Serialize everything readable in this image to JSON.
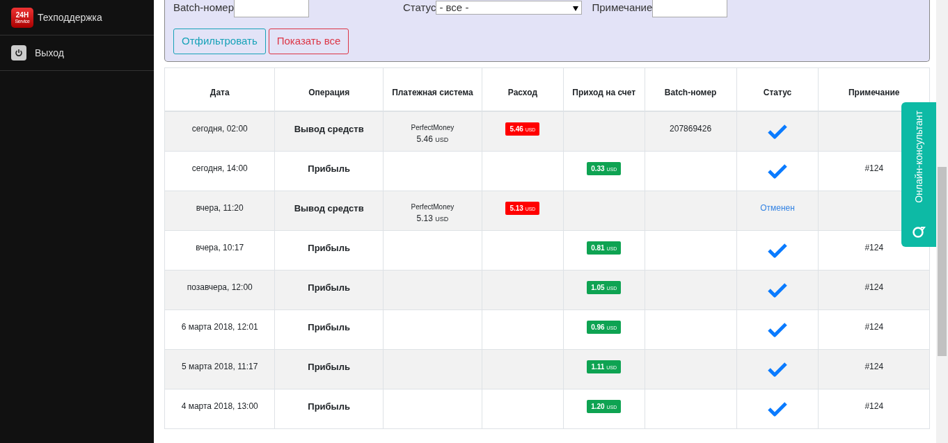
{
  "sidebar": {
    "items": [
      {
        "kind": "logo",
        "label": "Техподдержка",
        "logo_text": "24H",
        "logo_sub": "Service"
      },
      {
        "kind": "power",
        "label": "Выход"
      }
    ]
  },
  "filter": {
    "fields": [
      {
        "kind": "input",
        "label": "Batch-номер"
      },
      {
        "kind": "select",
        "label": "Статус",
        "value": "- все -"
      },
      {
        "kind": "input",
        "label": "Примечание"
      }
    ],
    "buttons": [
      {
        "kind": "info",
        "label": "Отфильтровать"
      },
      {
        "kind": "danger",
        "label": "Показать все"
      }
    ]
  },
  "table": {
    "columns": [
      "Дата",
      "Операция",
      "Платежная система",
      "Расход",
      "Приход на счет",
      "Batch-номер",
      "Статус",
      "Примечание"
    ],
    "rows": [
      {
        "date": "сегодня, 02:00",
        "operation": "Вывод средств",
        "payment": {
          "name": "PerfectMoney",
          "amount": "5.46",
          "currency": "USD"
        },
        "expense": {
          "amount": "5.46",
          "currency": "USD"
        },
        "batch": "207869426",
        "status": {
          "kind": "check"
        }
      },
      {
        "date": "сегодня, 14:00",
        "operation": "Прибыль",
        "income": {
          "amount": "0.33",
          "currency": "USD"
        },
        "status": {
          "kind": "check"
        },
        "note": "#124"
      },
      {
        "date": "вчера, 11:20",
        "operation": "Вывод средств",
        "payment": {
          "name": "PerfectMoney",
          "amount": "5.13",
          "currency": "USD"
        },
        "expense": {
          "amount": "5.13",
          "currency": "USD"
        },
        "status": {
          "kind": "text",
          "text": "Отменен"
        }
      },
      {
        "date": "вчера, 10:17",
        "operation": "Прибыль",
        "income": {
          "amount": "0.81",
          "currency": "USD"
        },
        "status": {
          "kind": "check"
        },
        "note": "#124"
      },
      {
        "date": "позавчера, 12:00",
        "operation": "Прибыль",
        "income": {
          "amount": "1.05",
          "currency": "USD"
        },
        "status": {
          "kind": "check"
        },
        "note": "#124"
      },
      {
        "date": "6 марта 2018, 12:01",
        "operation": "Прибыль",
        "income": {
          "amount": "0.96",
          "currency": "USD"
        },
        "status": {
          "kind": "check"
        },
        "note": "#124"
      },
      {
        "date": "5 марта 2018, 11:17",
        "operation": "Прибыль",
        "income": {
          "amount": "1.11",
          "currency": "USD"
        },
        "status": {
          "kind": "check"
        },
        "note": "#124"
      },
      {
        "date": "4 марта 2018, 13:00",
        "operation": "Прибыль",
        "income": {
          "amount": "1.20",
          "currency": "USD"
        },
        "status": {
          "kind": "check"
        },
        "note": "#124"
      }
    ]
  },
  "chat_widget": {
    "label": "Онлайн-консультант"
  }
}
